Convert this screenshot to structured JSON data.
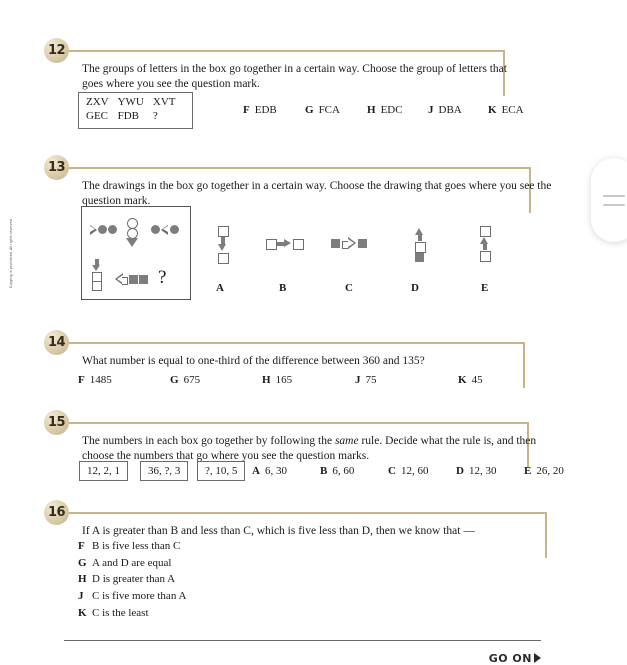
{
  "page": {
    "margin_note": "Copying is prohibited. All rights reserved.",
    "footer": {
      "go_on": "GO ON"
    }
  },
  "side_tab": {
    "icon": "hamburger-menu-icon"
  },
  "questions": [
    {
      "number": "12",
      "prompt": "The groups of letters in the box go together in a certain way. Choose the group of letters that goes where you see the question mark.",
      "stimulus": {
        "type": "letter-grid",
        "rows": [
          [
            "ZXV",
            "YWU",
            "XVT"
          ],
          [
            "GEC",
            "FDB",
            "?"
          ]
        ]
      },
      "choices": [
        {
          "letter": "F",
          "text": "EDB"
        },
        {
          "letter": "G",
          "text": "FCA"
        },
        {
          "letter": "H",
          "text": "EDC"
        },
        {
          "letter": "J",
          "text": "DBA"
        },
        {
          "letter": "K",
          "text": "ECA"
        }
      ]
    },
    {
      "number": "13",
      "prompt": "The drawings in the box go together in a certain way. Choose the drawing that goes where you see the question mark.",
      "stimulus": {
        "type": "figure-grid",
        "cells": [
          "triangle-right-open-two-filled-circles",
          "two-open-circles-above-filled-down-triangle",
          "filled-circle-left-triangle-filled-circle",
          "filled-down-arrow-above-two-open-squares",
          "left-arrow-open-two-filled-squares",
          "?"
        ],
        "question_mark": "?"
      },
      "choices": [
        {
          "letter": "A",
          "text": "",
          "figure": "open-square-filled-down-arrow-open-square"
        },
        {
          "letter": "B",
          "text": "",
          "figure": "open-square-filled-right-arrow-open-square"
        },
        {
          "letter": "C",
          "text": "",
          "figure": "filled-square-open-right-arrow-filled-square"
        },
        {
          "letter": "D",
          "text": "",
          "figure": "filled-up-arrow-open-square-filled-square"
        },
        {
          "letter": "E",
          "text": "",
          "figure": "open-square-filled-up-arrow-open-square"
        }
      ]
    },
    {
      "number": "14",
      "prompt": "What number is equal to one-third of the difference between 360 and 135?",
      "choices": [
        {
          "letter": "F",
          "text": "1485"
        },
        {
          "letter": "G",
          "text": "675"
        },
        {
          "letter": "H",
          "text": "165"
        },
        {
          "letter": "J",
          "text": "75"
        },
        {
          "letter": "K",
          "text": "45"
        }
      ]
    },
    {
      "number": "15",
      "prompt_parts": {
        "before": "The numbers in each box go together by following the ",
        "italic": "same",
        "after": " rule. Decide what the rule is, and then choose the numbers that go where you see the question marks."
      },
      "stimulus": {
        "type": "number-boxes",
        "boxes": [
          "12, 2, 1",
          "36, ?, 3",
          "?, 10, 5"
        ]
      },
      "choices": [
        {
          "letter": "A",
          "text": "6, 30"
        },
        {
          "letter": "B",
          "text": "6, 60"
        },
        {
          "letter": "C",
          "text": "12, 60"
        },
        {
          "letter": "D",
          "text": "12, 30"
        },
        {
          "letter": "E",
          "text": "26, 20"
        }
      ]
    },
    {
      "number": "16",
      "prompt": "If A is greater than B and less than C, which is five less than D, then we know that —",
      "choices": [
        {
          "letter": "F",
          "text": "B is five less than C"
        },
        {
          "letter": "G",
          "text": "A and D are equal"
        },
        {
          "letter": "H",
          "text": "D is greater than A"
        },
        {
          "letter": "J",
          "text": "C is five more than A"
        },
        {
          "letter": "K",
          "text": "C is the least"
        }
      ]
    }
  ],
  "colors": {
    "rule": "#c9b48a",
    "badge": "#ddceac",
    "shape_fill": "#7d7d7d",
    "shape_stroke": "#6e6e6e",
    "box_border": "#6b6b6b"
  }
}
